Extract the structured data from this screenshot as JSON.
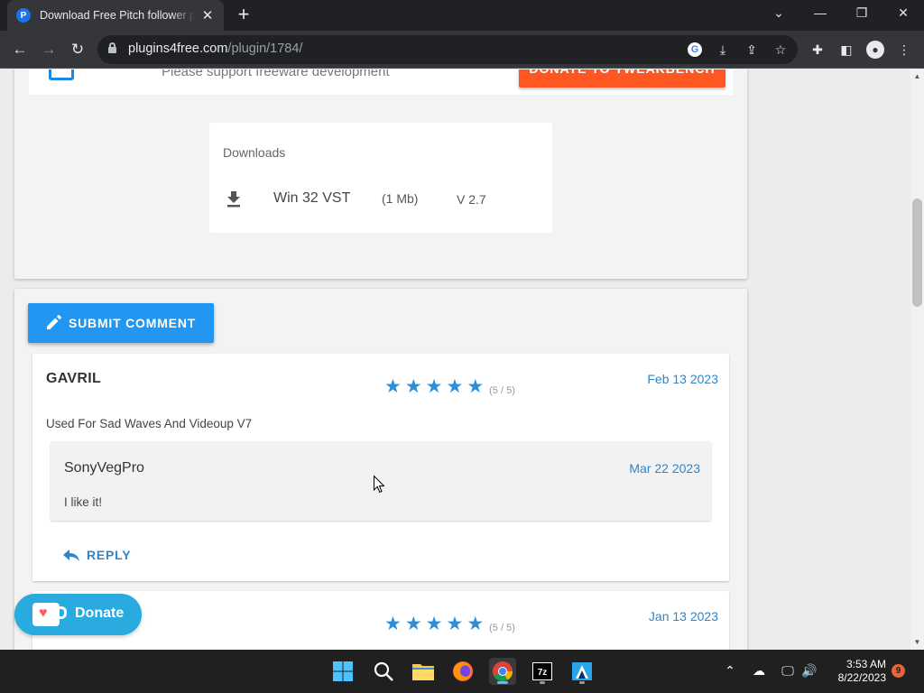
{
  "browser": {
    "tab_title": "Download Free Pitch follower plugin",
    "tab_favicon": "P",
    "new_tab": "+",
    "url_host": "plugins4free.com",
    "url_path": "/plugin/1784/"
  },
  "page": {
    "support_text": "Please support freeware development",
    "donate_button": "DONATE TO TWEAKBENCH",
    "downloads": {
      "title": "Downloads",
      "items": [
        {
          "name": "Win 32 VST",
          "size": "(1 Mb)",
          "version": "V 2.7"
        }
      ]
    },
    "submit_button": "SUBMIT COMMENT",
    "comments": [
      {
        "author": "GAVRIL",
        "rating": "(5 / 5)",
        "stars": 5,
        "date": "Feb 13 2023",
        "text": "Used For Sad Waves And Videoup V7",
        "reply": {
          "author": "SonyVegPro",
          "date": "Mar 22 2023",
          "text": "I like it!"
        },
        "reply_button": "REPLY"
      },
      {
        "author": "",
        "rating": "(5 / 5)",
        "stars": 5,
        "date": "Jan 13 2023"
      }
    ],
    "kofi_label": "Donate"
  },
  "taskbar": {
    "time": "3:53 AM",
    "date": "8/22/2023",
    "notification_count": "9"
  },
  "colors": {
    "accent_blue": "#2196f3",
    "donate_orange": "#ff5722",
    "star_blue": "#2e8fd8",
    "kofi_blue": "#29abe0"
  },
  "icons": [
    "search-icon",
    "windows-start-icon",
    "download-icon",
    "pencil-icon",
    "reply-icon",
    "star-icon",
    "heart-cup-icon"
  ]
}
